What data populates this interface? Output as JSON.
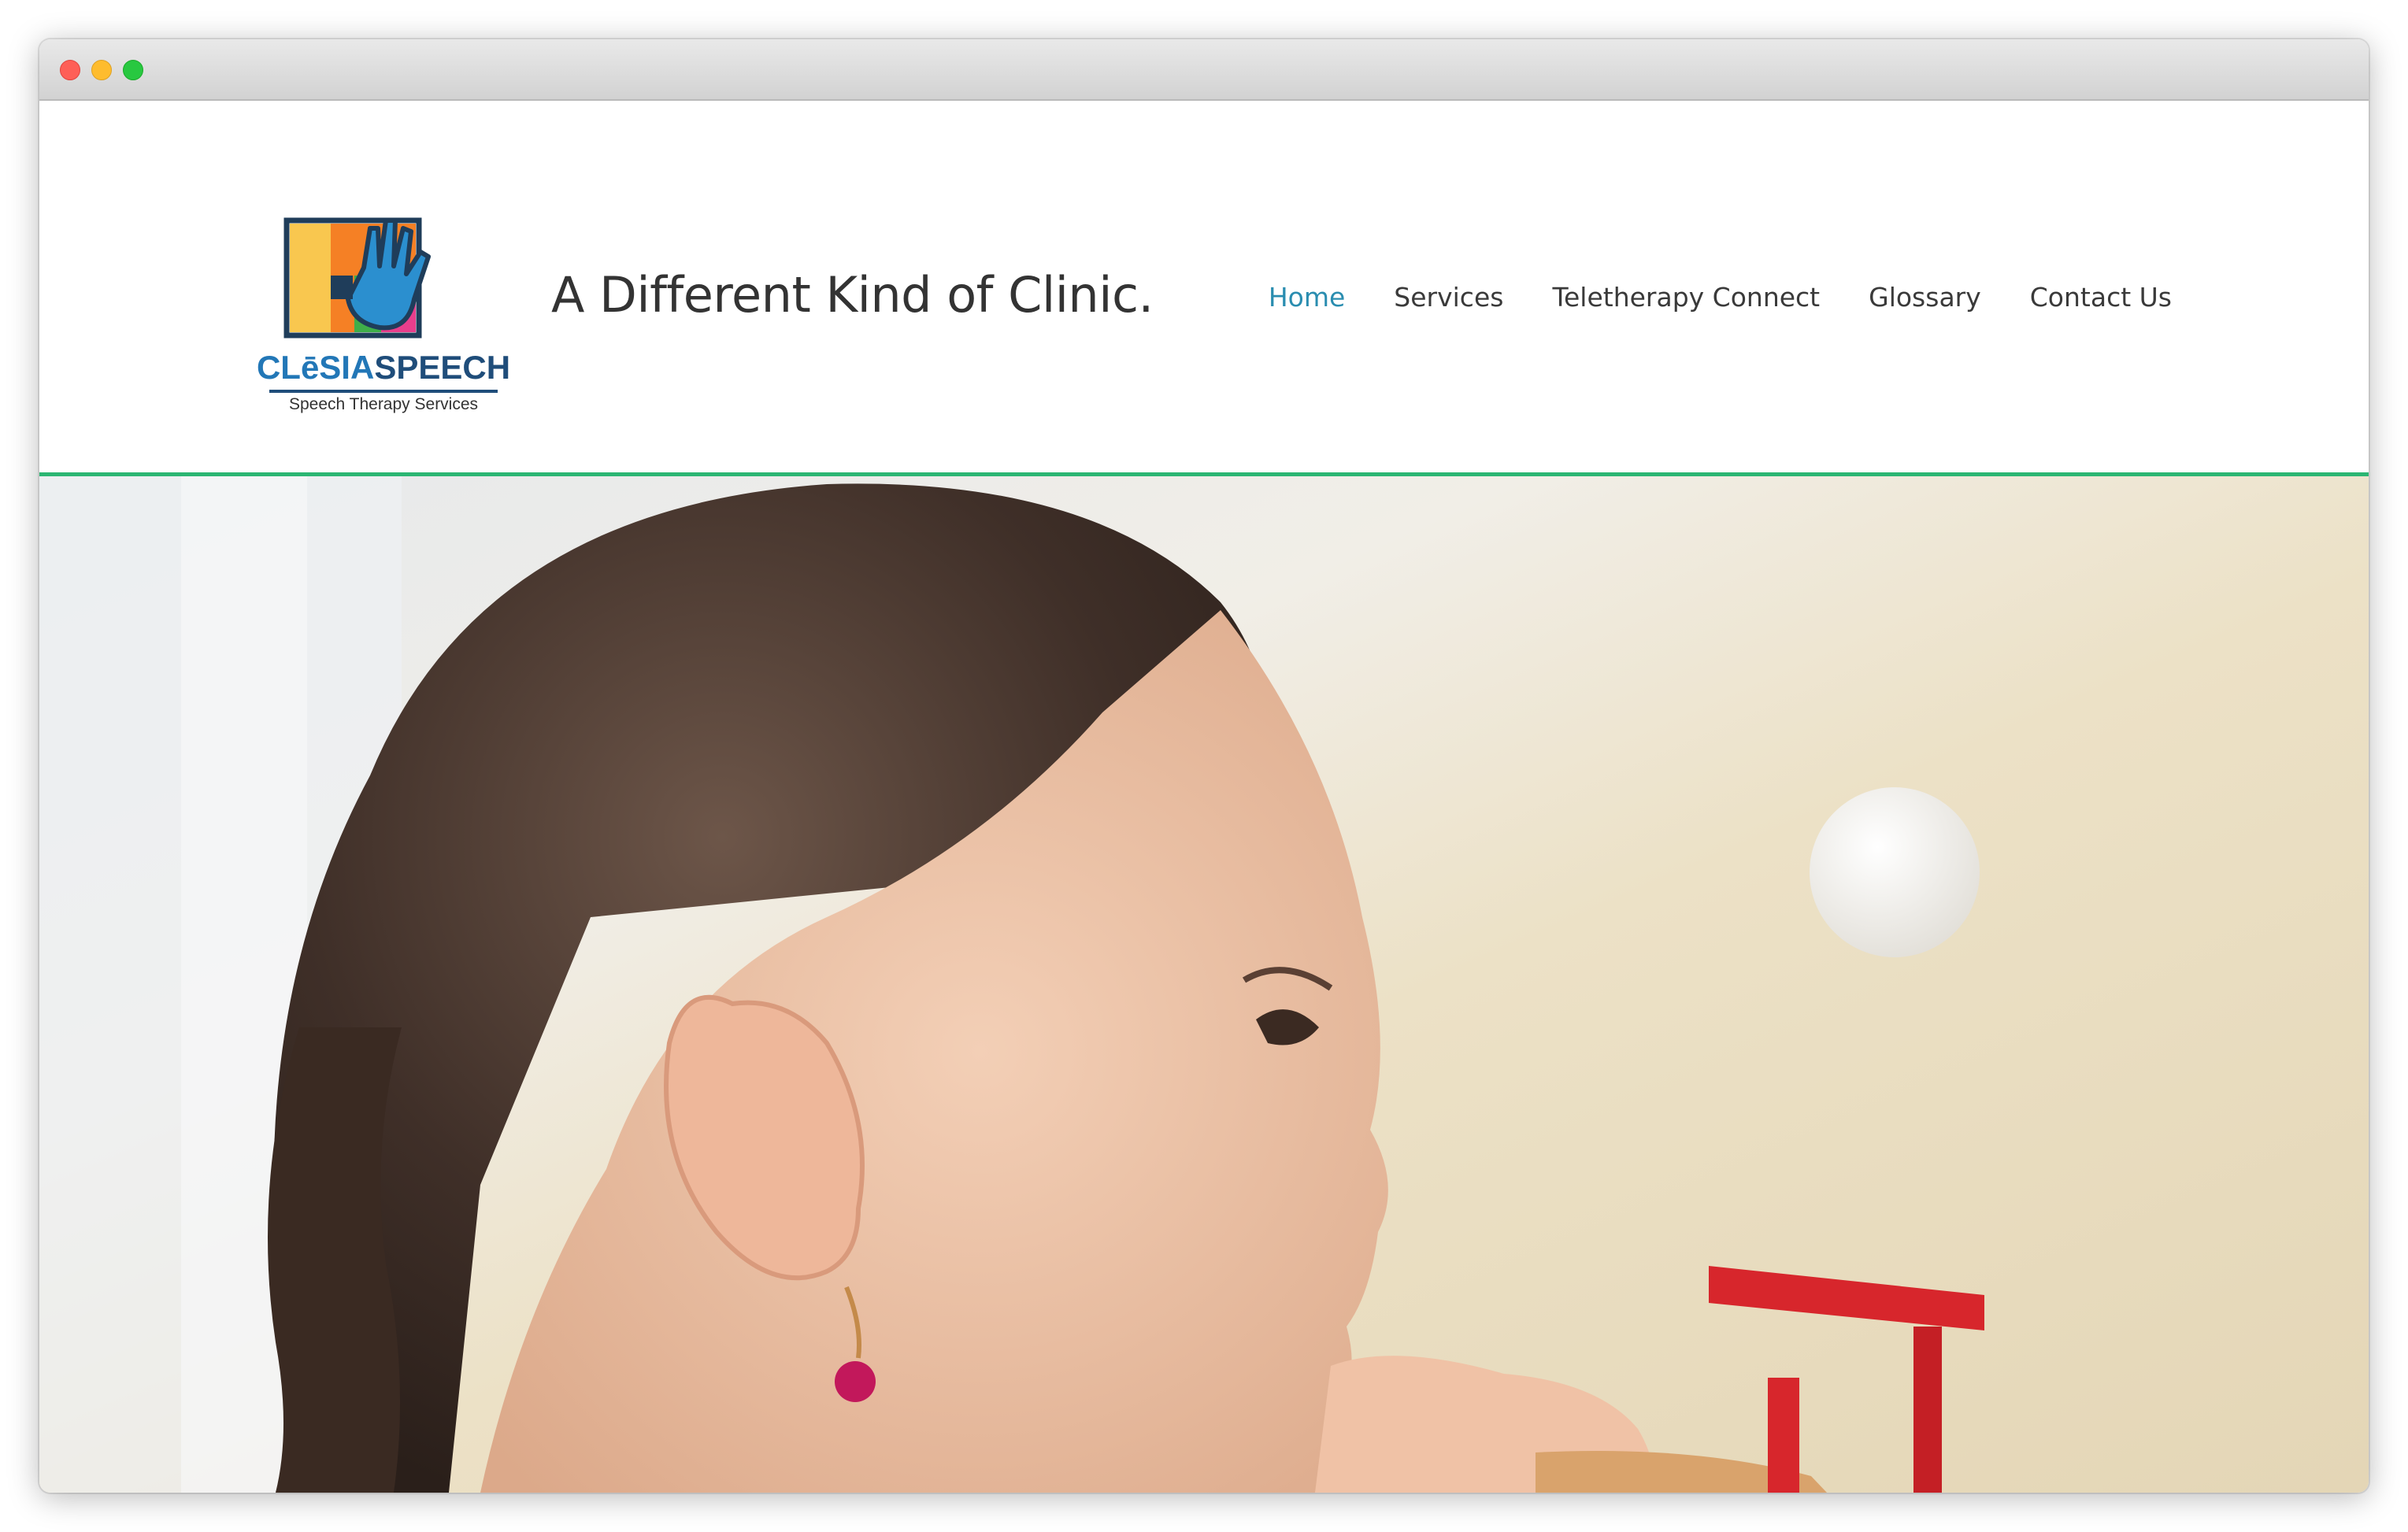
{
  "logo": {
    "brand_part1": "CLēSIA",
    "brand_part2": "SPEECH",
    "tagline": "Speech Therapy Services"
  },
  "header": {
    "tagline": "A Different Kind of Clinic."
  },
  "nav": {
    "items": [
      {
        "label": "Home",
        "active": true
      },
      {
        "label": "Services"
      },
      {
        "label": "Teletherapy Connect"
      },
      {
        "label": "Glossary"
      },
      {
        "label": "Contact Us"
      }
    ]
  },
  "colors": {
    "accent": "#2bb673",
    "nav_active": "#2a8db0",
    "logo_blue": "#2277b7"
  }
}
